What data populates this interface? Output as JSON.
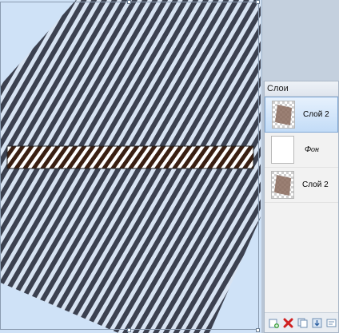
{
  "layers_panel": {
    "title": "Слои",
    "layers": [
      {
        "name": "Слой 2",
        "selected": true,
        "thumb": "checker-swatch"
      },
      {
        "name": "Фон",
        "selected": false,
        "thumb": "blank"
      },
      {
        "name": "Слой 2",
        "selected": false,
        "thumb": "checker-swatch"
      }
    ],
    "toolbar_icons": [
      "new-layer-icon",
      "delete-layer-icon",
      "duplicate-layer-icon",
      "merge-down-icon",
      "layer-properties-icon"
    ]
  },
  "colors": {
    "canvas_background": "#cfe2f7",
    "stripe_dark": "#3c4150",
    "stripe_light": "#d7e3f2",
    "band_dark": "#3a1f12",
    "band_light": "#ffffff",
    "selection_highlight": "#c3dcf7"
  }
}
